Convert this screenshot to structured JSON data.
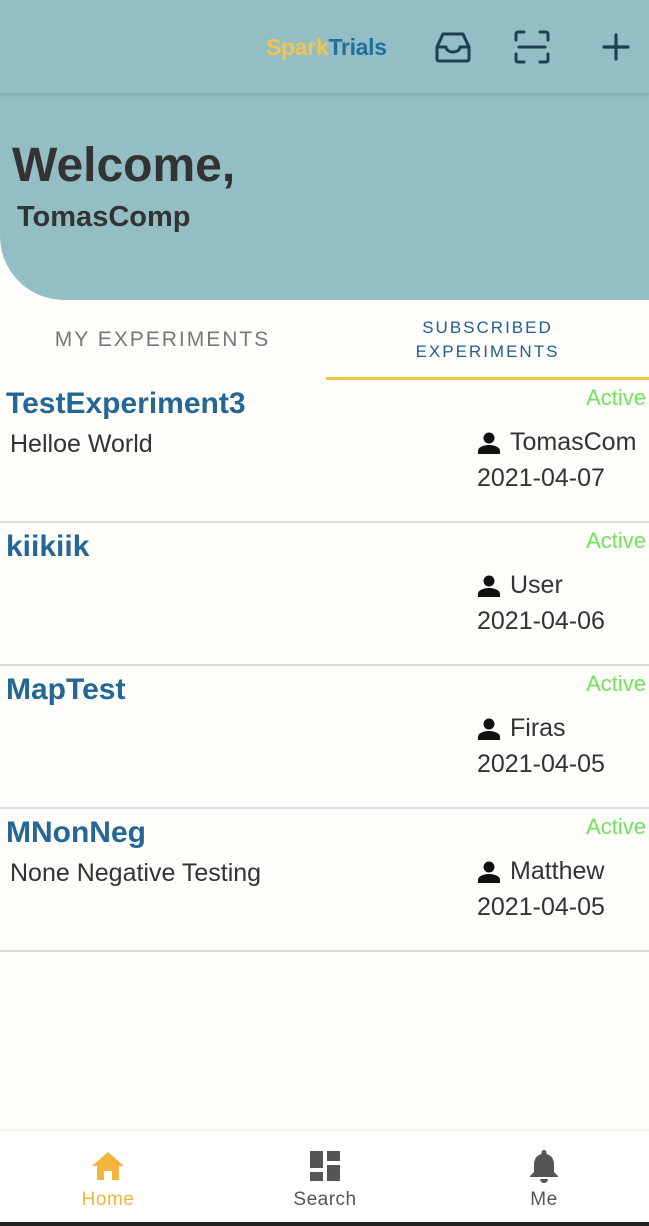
{
  "app": {
    "brand_part1": "Spark",
    "brand_part2": "Trials",
    "colors": {
      "header": "#93bec6",
      "brand_yellow": "#f2c44c",
      "brand_blue": "#226f9a",
      "active_green": "#6de45b"
    }
  },
  "toolbar": {
    "icons": [
      "inbox-icon",
      "scan-icon",
      "add-icon"
    ]
  },
  "header": {
    "welcome": "Welcome,",
    "username": "TomasComp"
  },
  "tabs": {
    "my_experiments": "MY EXPERIMENTS",
    "subscribed_line1": "SUBSCRIBED",
    "subscribed_line2": "EXPERIMENTS",
    "selected": "subscribed"
  },
  "experiments": [
    {
      "title": "TestExperiment3",
      "description": "Helloe World",
      "status": "Active",
      "owner": "TomasCom",
      "date": "2021-04-07"
    },
    {
      "title": "kiikiik",
      "description": "",
      "status": "Active",
      "owner": "User",
      "date": "2021-04-06"
    },
    {
      "title": "MapTest",
      "description": "",
      "status": "Active",
      "owner": "Firas",
      "date": "2021-04-05"
    },
    {
      "title": "MNonNeg",
      "description": "None Negative Testing",
      "status": "Active",
      "owner": "Matthew",
      "date": "2021-04-05"
    }
  ],
  "bottom_nav": {
    "home": "Home",
    "search": "Search",
    "me": "Me",
    "selected": "home"
  }
}
